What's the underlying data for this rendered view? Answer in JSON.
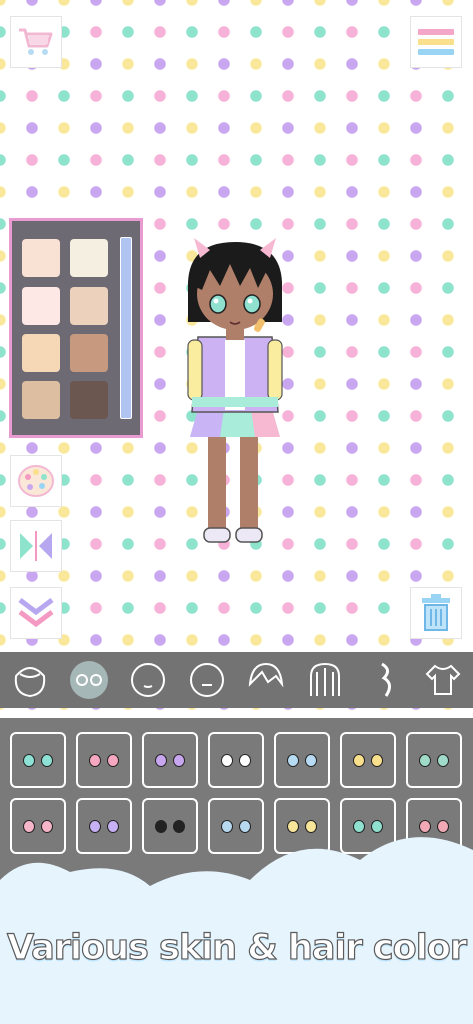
{
  "caption": "Various skin & hair color",
  "skin_swatches": [
    "#f9e2d4",
    "#f4efe0",
    "#fde8e5",
    "#ecd2bd",
    "#f7d8b6",
    "#c79a80",
    "#ddbea1",
    "#6b5650"
  ],
  "slider_color": "#b0c4f2",
  "tools": [
    "head-shape",
    "eyes",
    "face",
    "mouth",
    "hair-front",
    "hair-back",
    "hair-side",
    "clothes"
  ],
  "eye_colors": [
    "#8ee1d5",
    "#f6a8c0",
    "#c9a6f0",
    "#ffffff",
    "#b7dbf3",
    "#fae08c",
    "#9fdbc8",
    "#f6b5c8",
    "#c7b0f3",
    "#222222",
    "#b7d9f0",
    "#f7e69a",
    "#8fe0cf",
    "#f2a9b6"
  ],
  "colors": {
    "panel_border": "#e89bd0",
    "panel_bg": "#6e6a73",
    "toolbar": "#737373",
    "cloud": "#e6f4fd"
  }
}
